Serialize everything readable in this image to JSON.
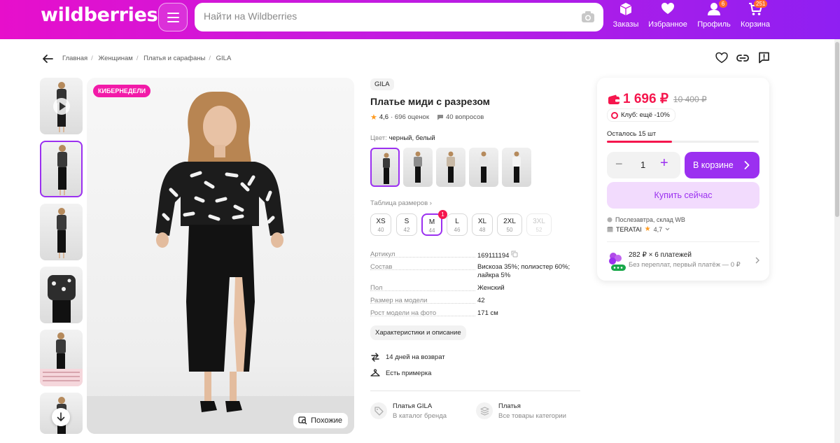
{
  "header": {
    "logo": "wildberries",
    "search_placeholder": "Найти на Wildberries",
    "nav": [
      {
        "label": "Заказы",
        "icon": "box-icon"
      },
      {
        "label": "Избранное",
        "icon": "heart-icon"
      },
      {
        "label": "Профиль",
        "icon": "user-icon",
        "badge": "6"
      },
      {
        "label": "Корзина",
        "icon": "cart-icon",
        "badge": "251"
      }
    ]
  },
  "breadcrumbs": [
    "Главная",
    "Женщинам",
    "Платья и сарафаны",
    "GILA"
  ],
  "gallery": {
    "promo_label": "КИБЕРНЕДЕЛИ",
    "similar_label": "Похожие"
  },
  "product": {
    "brand": "GILA",
    "title": "Платье миди с разрезом",
    "rating": "4,6",
    "reviews": "· 696 оценок",
    "questions": "40 вопросов",
    "color_label": "Цвет:",
    "color_value": "черный, белый",
    "size_table_label": "Таблица размеров",
    "sizes": [
      {
        "size": "XS",
        "ru": "40"
      },
      {
        "size": "S",
        "ru": "42"
      },
      {
        "size": "M",
        "ru": "44"
      },
      {
        "size": "L",
        "ru": "46"
      },
      {
        "size": "XL",
        "ru": "48"
      },
      {
        "size": "2XL",
        "ru": "50"
      },
      {
        "size": "3XL",
        "ru": "52"
      }
    ],
    "selected_size_badge": "1",
    "params": [
      {
        "key": "Артикул",
        "value": "169111194"
      },
      {
        "key": "Состав",
        "value": "Вискоза 35%; полиэстер 60%; лайкра 5%"
      },
      {
        "key": "Пол",
        "value": "Женский"
      },
      {
        "key": "Размер на модели",
        "value": "42"
      },
      {
        "key": "Рост модели на фото",
        "value": "171 см"
      }
    ],
    "chars_button": "Характеристики и описание",
    "features": [
      "14 дней на возврат",
      "Есть примерка"
    ],
    "shortcuts": [
      {
        "title": "Платья GILA",
        "subtitle": "В каталог бренда"
      },
      {
        "title": "Платья",
        "subtitle": "Все товары категории"
      }
    ]
  },
  "buy_card": {
    "price": "1 696 ₽",
    "old_price": "10 400 ₽",
    "club": "Клуб: ещё -10%",
    "stock": "Осталось 15 шт",
    "stock_fraction": 0.43,
    "quantity": "1",
    "in_cart_label": "В корзине",
    "buy_now_label": "Купить сейчас",
    "delivery": "Послезавтра, склад WB",
    "seller": "TERATAI",
    "seller_rating": "4,7",
    "installment_title": "282 ₽ × 6 платежей",
    "installment_sub": "Без переплат, первый платёж — 0 ₽"
  },
  "colors": {
    "accent": "#9b30f0",
    "price": "#f5164d",
    "header_start": "#e70fcb",
    "header_end": "#8f1ff2"
  }
}
